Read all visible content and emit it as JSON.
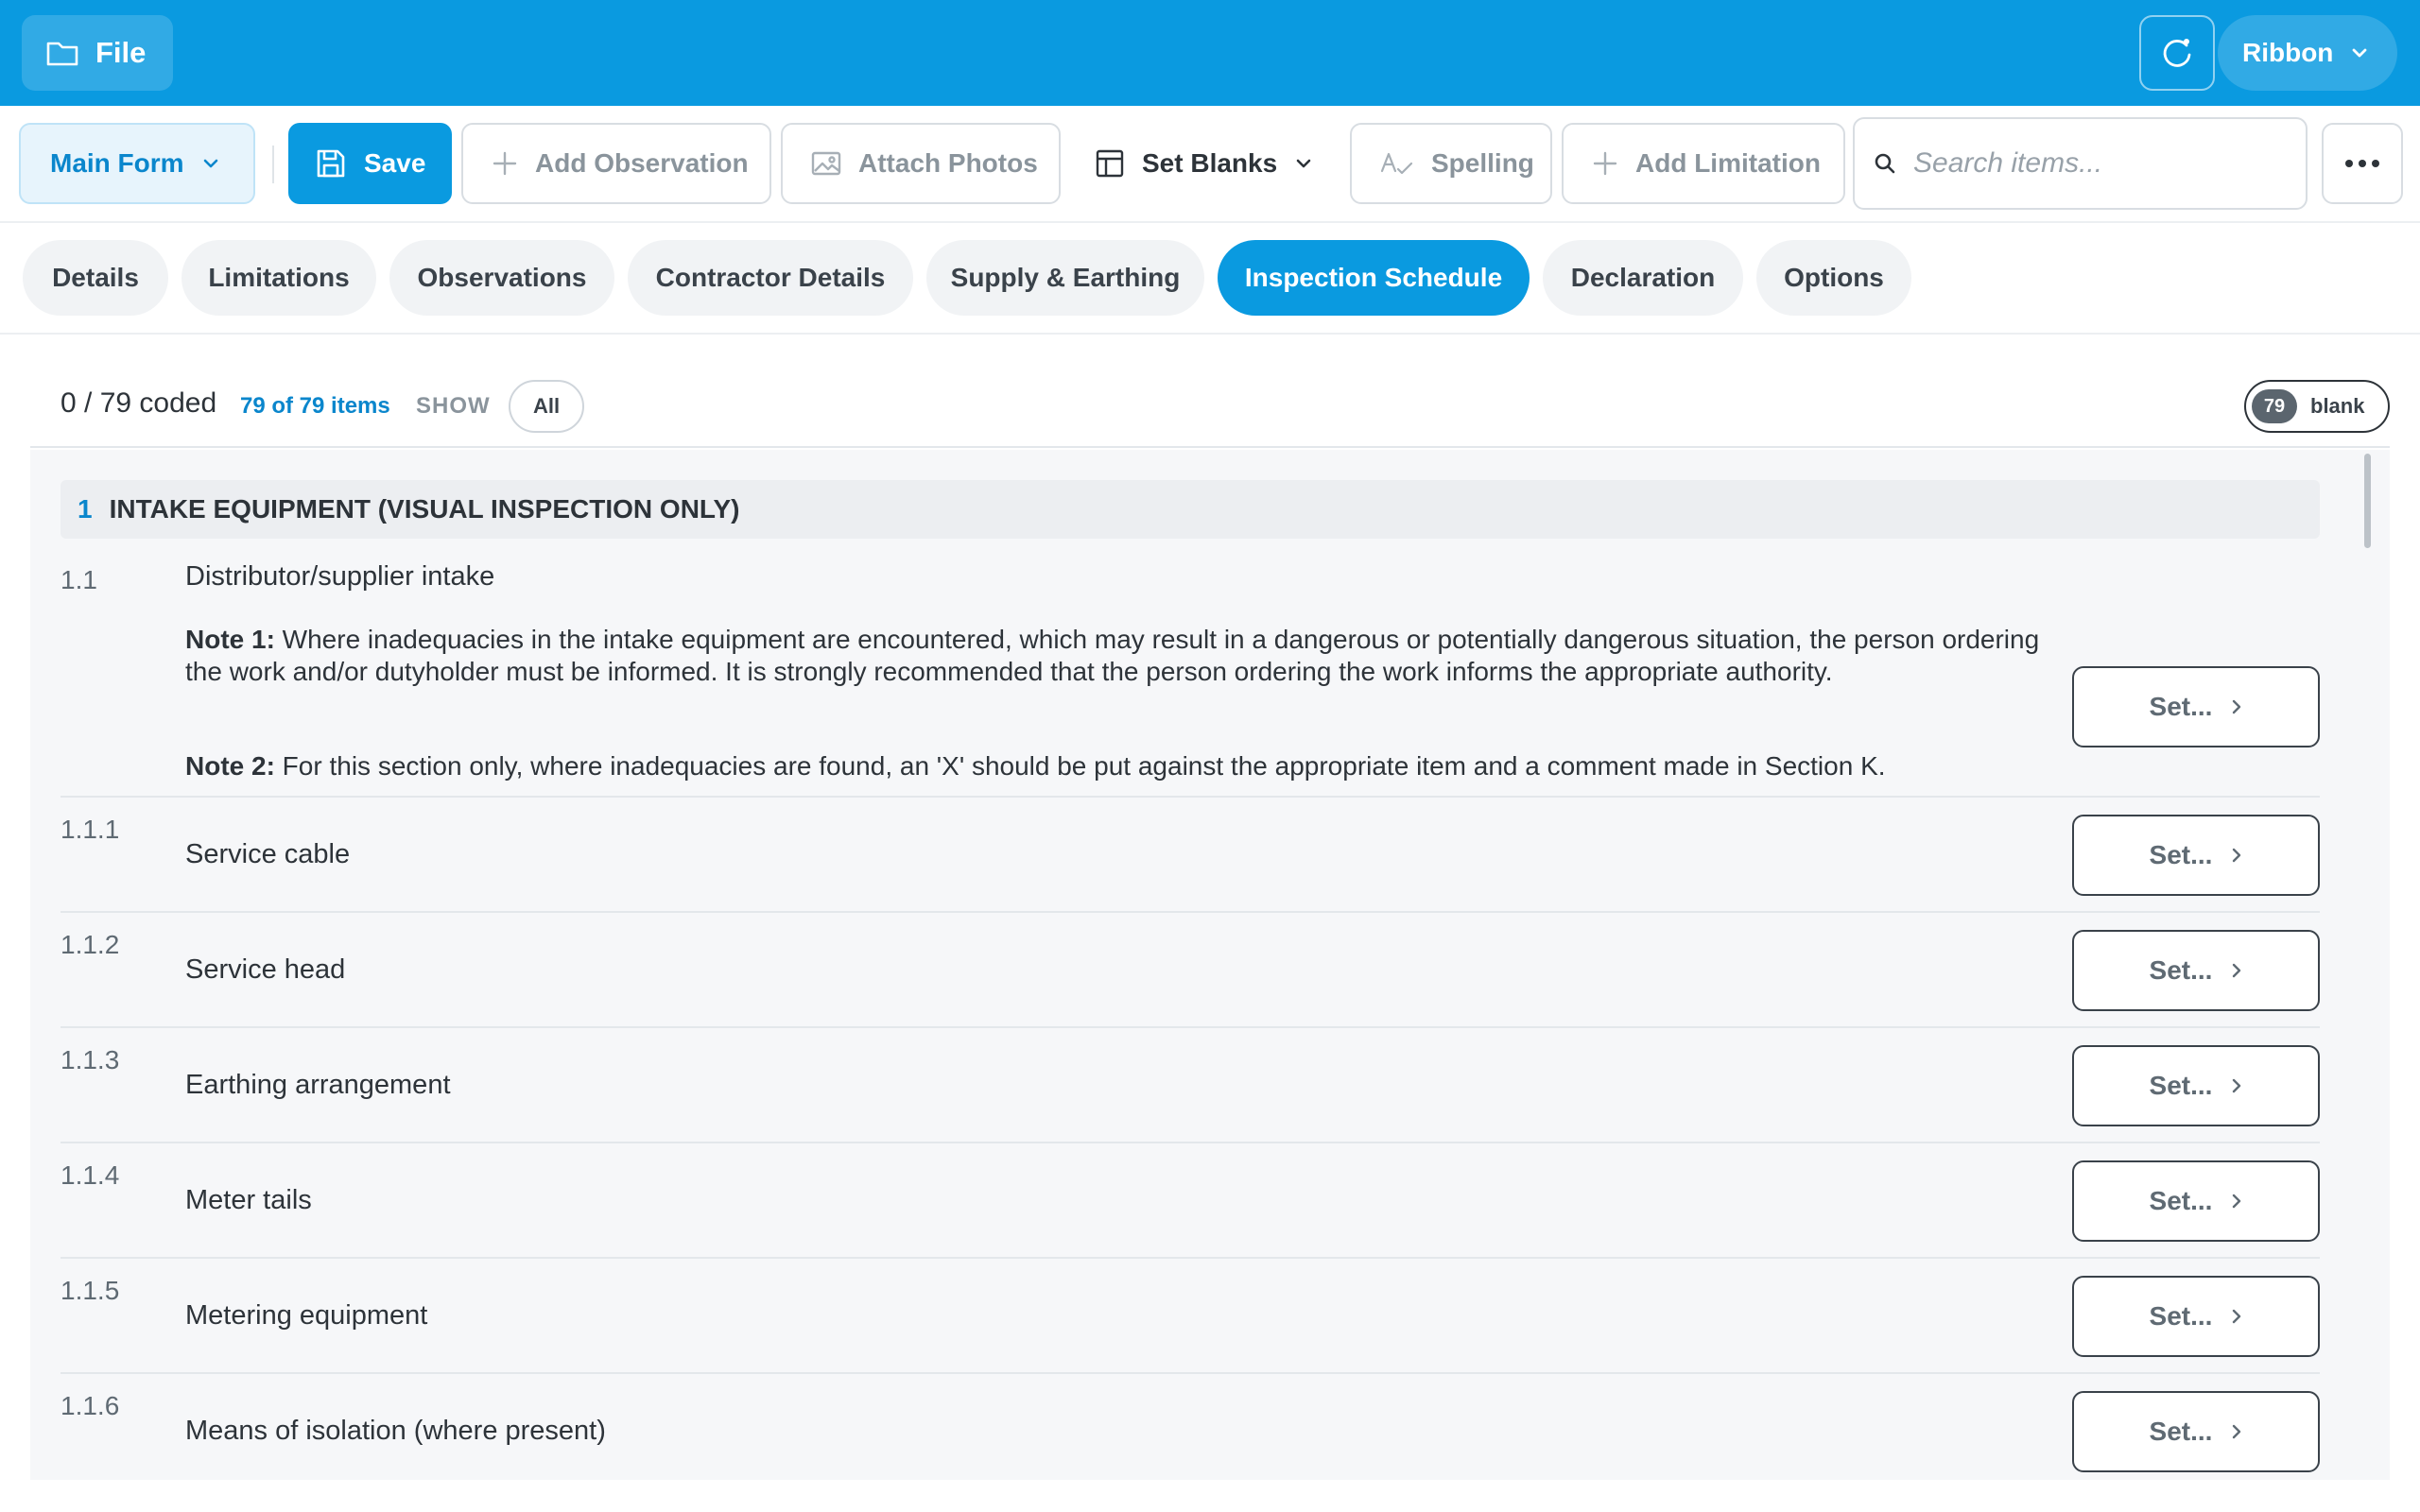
{
  "topbar": {
    "file_label": "File",
    "ribbon_label": "Ribbon",
    "accent": "#0a9ae0"
  },
  "toolbar": {
    "main_form_label": "Main Form",
    "save_label": "Save",
    "add_observation_label": "Add Observation",
    "attach_photos_label": "Attach Photos",
    "set_blanks_label": "Set Blanks",
    "spelling_label": "Spelling",
    "add_limitation_label": "Add Limitation",
    "search_placeholder": "Search items..."
  },
  "tabs": [
    {
      "label": "Details",
      "active": false
    },
    {
      "label": "Limitations",
      "active": false
    },
    {
      "label": "Observations",
      "active": false
    },
    {
      "label": "Contractor Details",
      "active": false
    },
    {
      "label": "Supply & Earthing",
      "active": false
    },
    {
      "label": "Inspection Schedule",
      "active": true
    },
    {
      "label": "Declaration",
      "active": false
    },
    {
      "label": "Options",
      "active": false
    }
  ],
  "summary": {
    "coded": "0 / 79 coded",
    "items_count": "79 of 79 items",
    "show_label": "SHOW",
    "filter_value": "All",
    "blank_count": "79",
    "blank_label": "blank"
  },
  "section": {
    "number": "1",
    "title": "INTAKE EQUIPMENT (VISUAL INSPECTION ONLY)"
  },
  "intro_item": {
    "number": "1.1",
    "label": "Distributor/supplier intake",
    "note1_prefix": "Note 1:",
    "note1_text": " Where inadequacies in the intake equipment are encountered, which may result in a dangerous or potentially dangerous situation, the person ordering the work and/or dutyholder must be informed. It is strongly recommended that the person ordering the work informs the appropriate authority.",
    "note2_prefix": "Note 2:",
    "note2_text": " For this section only, where inadequacies are found, an 'X' should be put against the appropriate item and a comment made in Section K.",
    "set_label": "Set..."
  },
  "items": [
    {
      "number": "1.1.1",
      "label": "Service cable",
      "set_label": "Set..."
    },
    {
      "number": "1.1.2",
      "label": "Service head",
      "set_label": "Set..."
    },
    {
      "number": "1.1.3",
      "label": "Earthing arrangement",
      "set_label": "Set..."
    },
    {
      "number": "1.1.4",
      "label": "Meter tails",
      "set_label": "Set..."
    },
    {
      "number": "1.1.5",
      "label": "Metering equipment",
      "set_label": "Set..."
    },
    {
      "number": "1.1.6",
      "label": "Means of isolation (where present)",
      "set_label": "Set..."
    }
  ]
}
